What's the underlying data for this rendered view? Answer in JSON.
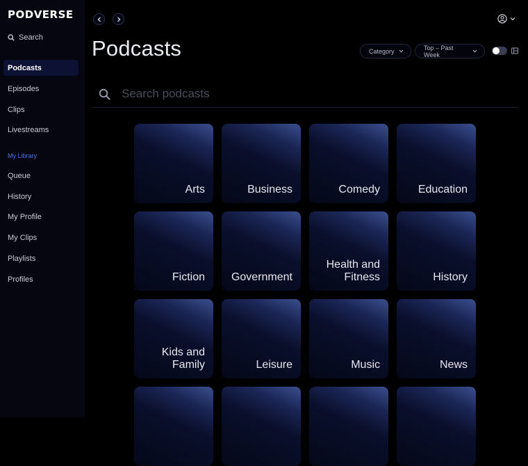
{
  "brand": {
    "logo_text": "PODVERSE"
  },
  "sidebar": {
    "search_label": "Search",
    "items": [
      {
        "label": "Podcasts",
        "active": true
      },
      {
        "label": "Episodes"
      },
      {
        "label": "Clips"
      },
      {
        "label": "Livestreams"
      }
    ],
    "library_label": "My Library",
    "library_items": [
      {
        "label": "Queue"
      },
      {
        "label": "History"
      },
      {
        "label": "My Profile"
      },
      {
        "label": "My Clips"
      },
      {
        "label": "Playlists"
      },
      {
        "label": "Profiles"
      }
    ]
  },
  "header": {
    "title": "Podcasts",
    "category_dropdown": "Category",
    "sort_dropdown": "Top – Past Week",
    "toggle_on": false
  },
  "search": {
    "placeholder": "Search podcasts",
    "value": ""
  },
  "categories": [
    {
      "label": "Arts"
    },
    {
      "label": "Business"
    },
    {
      "label": "Comedy"
    },
    {
      "label": "Education"
    },
    {
      "label": "Fiction"
    },
    {
      "label": "Government"
    },
    {
      "label": "Health and Fitness"
    },
    {
      "label": "History"
    },
    {
      "label": "Kids and Family"
    },
    {
      "label": "Leisure"
    },
    {
      "label": "Music"
    },
    {
      "label": "News"
    },
    {
      "label": ""
    },
    {
      "label": ""
    },
    {
      "label": ""
    },
    {
      "label": ""
    }
  ],
  "colors": {
    "accent": "#4d78e8",
    "active_nav_bg": "#0d1235",
    "background": "#000000"
  },
  "icons": {
    "search": "search-icon",
    "back": "chevron-left-icon",
    "forward": "chevron-right-icon",
    "user": "user-circle-icon",
    "dropdown": "chevron-down-icon",
    "layout": "grid-view-icon"
  }
}
